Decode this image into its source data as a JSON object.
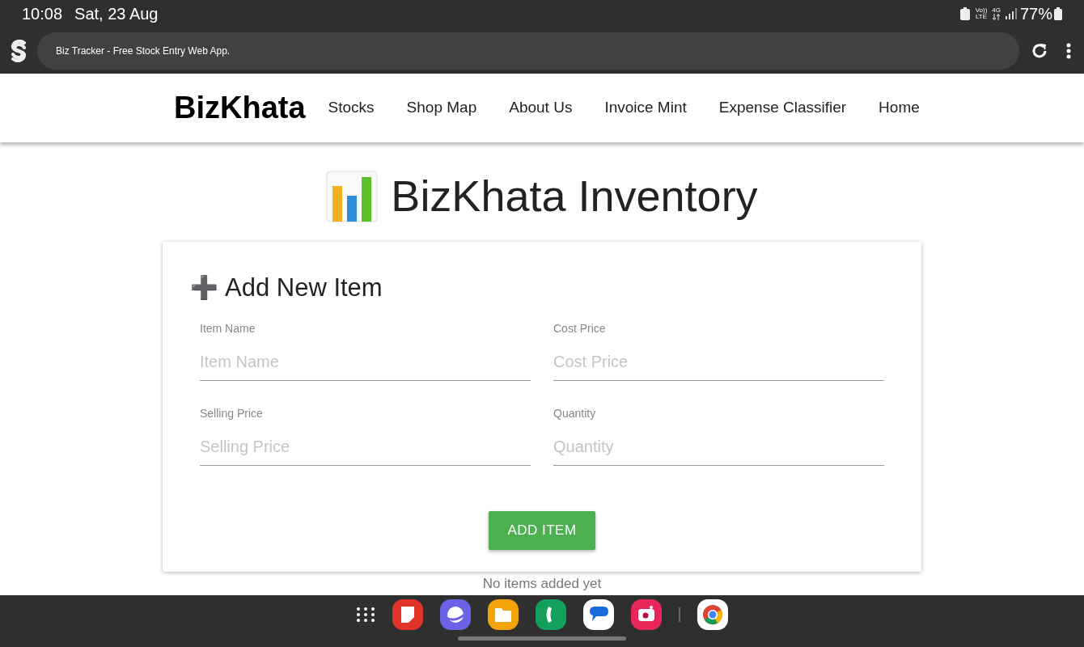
{
  "status_bar": {
    "time": "10:08",
    "date": "Sat, 23 Aug",
    "volte_top": "Vo))",
    "volte_bottom": "LTE",
    "network": "4G",
    "battery": "77%"
  },
  "browser": {
    "title": "Biz Tracker - Free Stock Entry Web App."
  },
  "navbar": {
    "brand": "BizKhata",
    "links": [
      "Stocks",
      "Shop Map",
      "About Us",
      "Invoice Mint",
      "Expense Classifier",
      "Home"
    ]
  },
  "page": {
    "title": "BizKhata Inventory"
  },
  "form": {
    "icon": "➕",
    "title": "Add New Item",
    "fields": [
      {
        "label": "Item Name",
        "placeholder": "Item Name"
      },
      {
        "label": "Cost Price",
        "placeholder": "Cost Price"
      },
      {
        "label": "Selling Price",
        "placeholder": "Selling Price"
      },
      {
        "label": "Quantity",
        "placeholder": "Quantity"
      }
    ],
    "button": "ADD ITEM"
  },
  "empty_message": "No items added yet"
}
